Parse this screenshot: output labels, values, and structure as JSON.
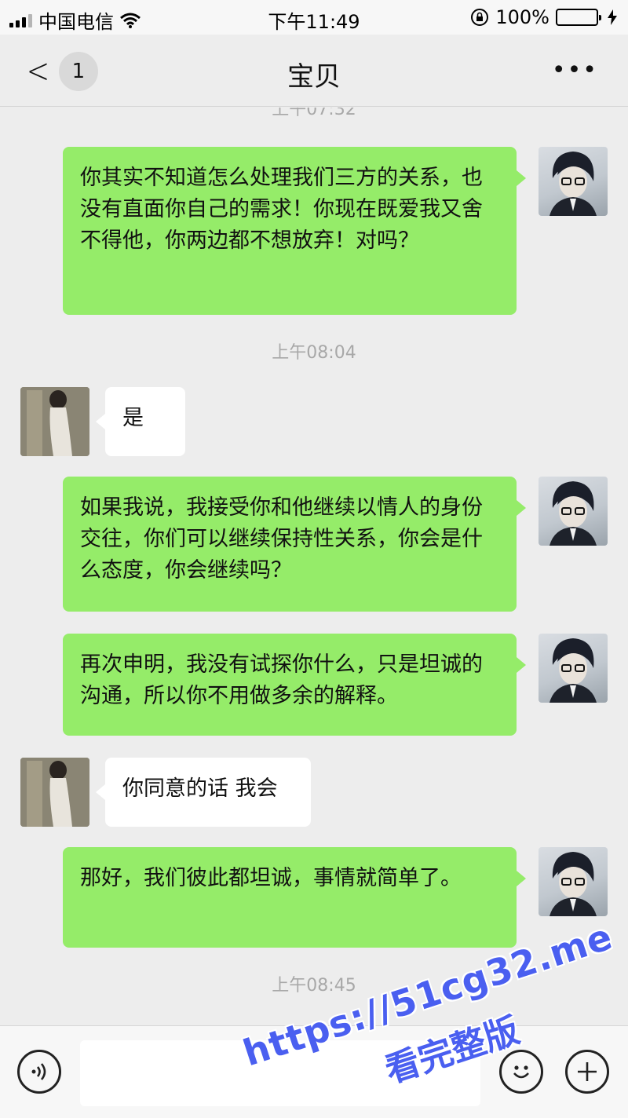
{
  "status_bar": {
    "carrier": "中国电信",
    "time": "下午11:49",
    "battery_percent": "100%",
    "signal_bars": 3,
    "icons": [
      "signal-icon",
      "wifi-icon",
      "orientation-lock-icon",
      "battery-icon",
      "charging-icon"
    ]
  },
  "nav": {
    "unread_count": "1",
    "title": "宝贝",
    "back_icon": "chevron-left-icon",
    "more_icon": "more-icon"
  },
  "chat": {
    "timestamp_top_partial": "上午07:32",
    "msg1": "你其实不知道怎么处理我们三方的关系，也没有直面你自己的需求！你现在既爱我又舍不得他，你两边都不想放弃！对吗？",
    "timestamp_2": "上午08:04",
    "msg2": "是",
    "msg3": "如果我说，我接受你和他继续以情人的身份交往，你们可以继续保持性关系，你会是什么态度，你会继续吗？",
    "msg4": "再次申明，我没有试探你什么，只是坦诚的沟通，所以你不用做多余的解释。",
    "msg5": "你同意的话 我会",
    "msg6": "那好，我们彼此都坦诚，事情就简单了。",
    "timestamp_3": "上午08:45"
  },
  "input_bar": {
    "voice_icon": "voice-icon",
    "emoji_icon": "emoji-icon",
    "plus_icon": "plus-icon",
    "text_value": ""
  },
  "watermark": {
    "url": "https://51cg32.me",
    "text": "看完整版"
  },
  "colors": {
    "self_bubble": "#95ec69",
    "other_bubble": "#ffffff",
    "background": "#ededed",
    "watermark": "#4a5ff0"
  }
}
